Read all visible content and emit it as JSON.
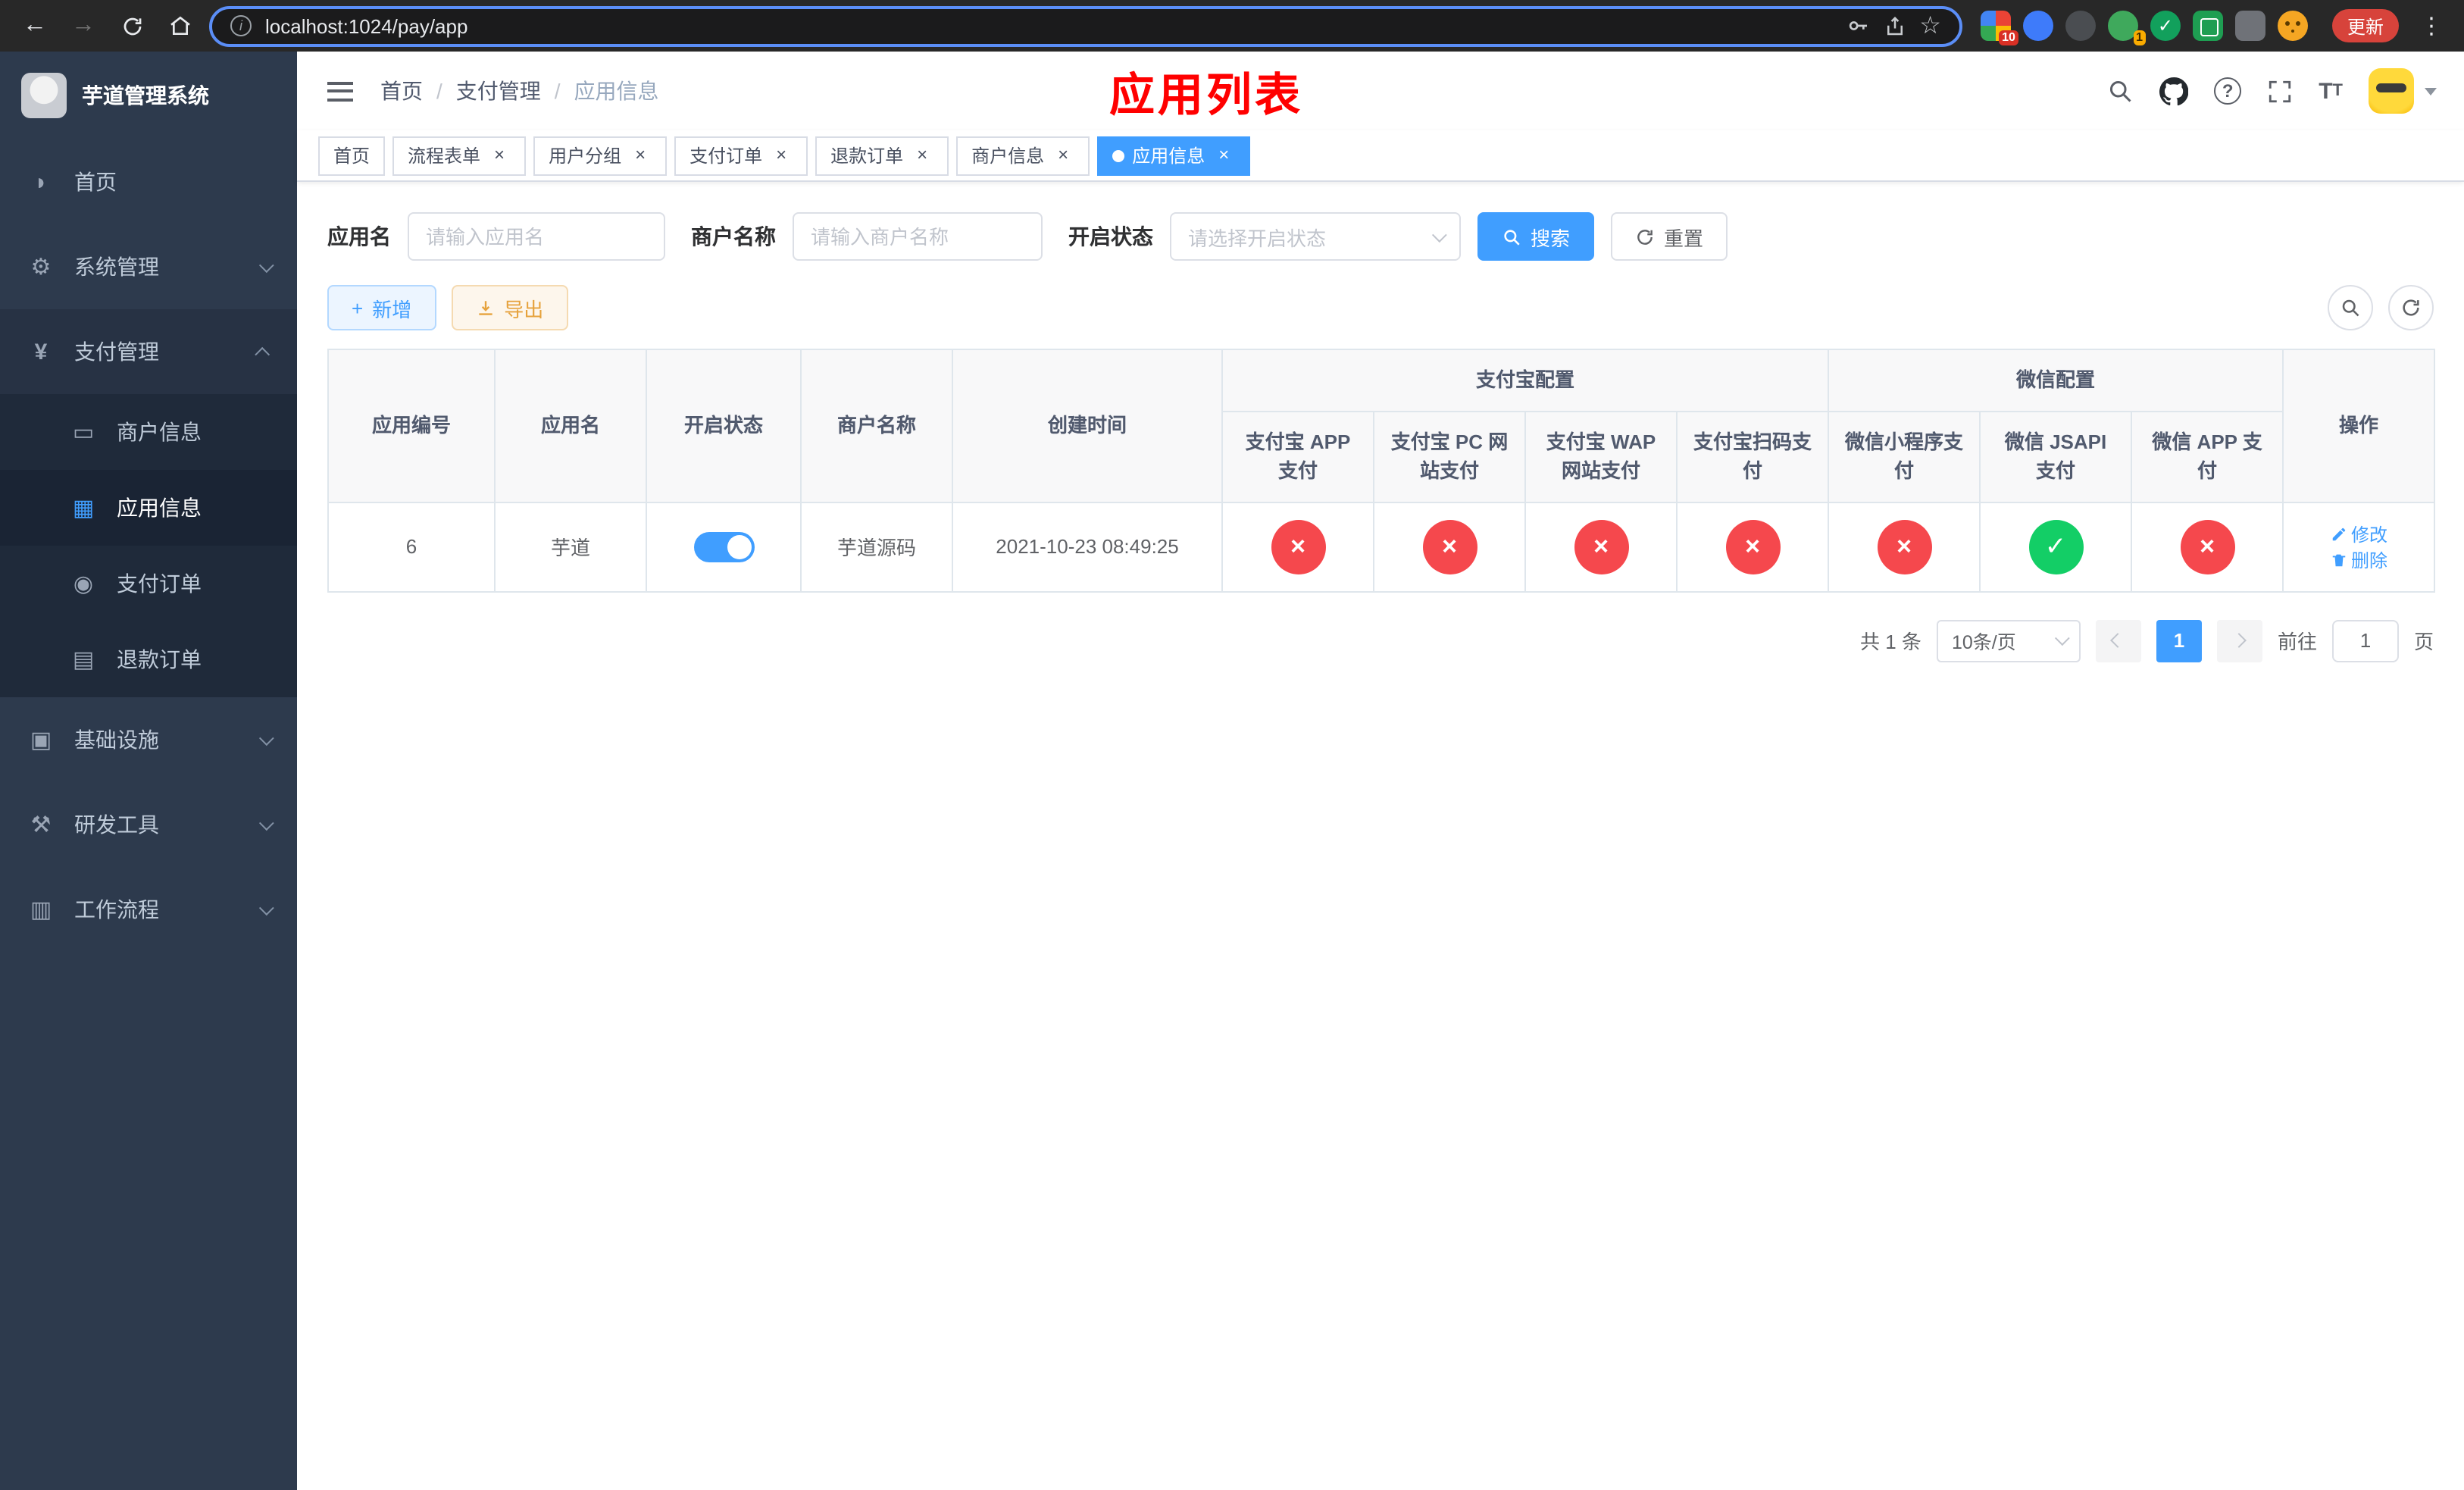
{
  "browser": {
    "url": "localhost:1024/pay/app",
    "update_label": "更新",
    "ext_badge_1": "10",
    "ext_badge_2": "1"
  },
  "sidebar": {
    "app_title": "芋道管理系统",
    "items": [
      {
        "label": "首页"
      },
      {
        "label": "系统管理"
      },
      {
        "label": "支付管理",
        "children": [
          {
            "label": "商户信息"
          },
          {
            "label": "应用信息"
          },
          {
            "label": "支付订单"
          },
          {
            "label": "退款订单"
          }
        ]
      },
      {
        "label": "基础设施"
      },
      {
        "label": "研发工具"
      },
      {
        "label": "工作流程"
      }
    ]
  },
  "header": {
    "breadcrumb": [
      "首页",
      "支付管理",
      "应用信息"
    ],
    "banner": "应用列表"
  },
  "tabs": [
    {
      "label": "首页"
    },
    {
      "label": "流程表单"
    },
    {
      "label": "用户分组"
    },
    {
      "label": "支付订单"
    },
    {
      "label": "退款订单"
    },
    {
      "label": "商户信息"
    },
    {
      "label": "应用信息"
    }
  ],
  "filters": {
    "app_name_label": "应用名",
    "app_name_placeholder": "请输入应用名",
    "merchant_label": "商户名称",
    "merchant_placeholder": "请输入商户名称",
    "status_label": "开启状态",
    "status_placeholder": "请选择开启状态",
    "search_label": "搜索",
    "reset_label": "重置"
  },
  "toolbar": {
    "add_label": "新增",
    "export_label": "导出"
  },
  "table": {
    "col_id": "应用编号",
    "col_name": "应用名",
    "col_status": "开启状态",
    "col_merchant": "商户名称",
    "col_created": "创建时间",
    "col_actions": "操作",
    "group_alipay": "支付宝配置",
    "group_wechat": "微信配置",
    "channel_cols": [
      "支付宝 APP 支付",
      "支付宝 PC 网站支付",
      "支付宝 WAP 网站支付",
      "支付宝扫码支付",
      "微信小程序支付",
      "微信 JSAPI 支付",
      "微信 APP 支付"
    ],
    "rows": [
      {
        "id": "6",
        "name": "芋道",
        "enabled": true,
        "merchant": "芋道源码",
        "created": "2021-10-23 08:49:25",
        "channels": [
          "no",
          "no",
          "no",
          "no",
          "no",
          "yes",
          "no"
        ],
        "edit_label": "修改",
        "delete_label": "删除"
      }
    ]
  },
  "pagination": {
    "total": "共 1 条",
    "page_size": "10条/页",
    "page": "1",
    "goto_label": "前往",
    "goto_value": "1",
    "unit_label": "页"
  },
  "colors": {
    "accent": "#409eff",
    "danger": "#f5484d",
    "success": "#13ce66",
    "banner_red": "#ff0000"
  }
}
